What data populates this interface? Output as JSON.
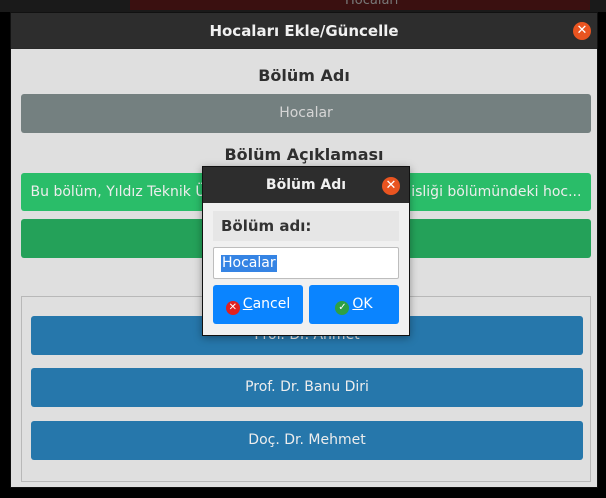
{
  "background": {
    "partial_text": "Hocaları"
  },
  "window": {
    "title": "Hocaları Ekle/Güncelle",
    "section1_label": "Bölüm Adı",
    "section1_value": "Hocalar",
    "section2_label": "Bölüm Açıklaması",
    "section2_value": "Bu bölüm, Yıldız Teknik Üniversitesi Bilgisayar Mühendisliği bölümündeki hoc...",
    "list": [
      "Prof. Dr. Ahmet",
      "Prof. Dr. Banu Diri",
      "Doç. Dr. Mehmet"
    ]
  },
  "dialog": {
    "title": "Bölüm Adı",
    "label": "Bölüm adı:",
    "input_value": "Hocalar",
    "cancel_first": "C",
    "cancel_rest": "ancel",
    "ok_first": "O",
    "ok_rest": "K"
  },
  "colors": {
    "title_bar": "#2d2d2d",
    "close_button": "#e95420",
    "gray_bar": "#7d8a8a",
    "green_field": "#2ecc71",
    "green_button": "#27ae60",
    "list_item": "#2980b9",
    "dialog_button": "#0a84ff"
  }
}
